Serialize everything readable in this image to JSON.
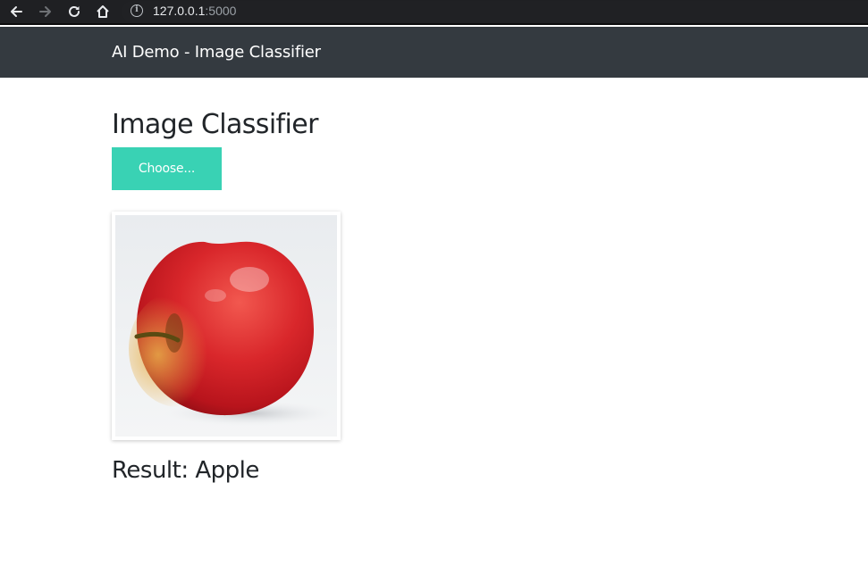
{
  "browser": {
    "url_host": "127.0.0.1",
    "url_port": ":5000"
  },
  "navbar": {
    "brand": "AI Demo - Image Classifier"
  },
  "main": {
    "title": "Image Classifier",
    "choose_label": "Choose...",
    "preview_image": "apple-photo",
    "result_prefix": "Result: ",
    "result_value": "Apple"
  },
  "colors": {
    "navbar": "#343a40",
    "accent": "#39d2b4",
    "text": "#212529",
    "chrome": "#1f2023"
  }
}
